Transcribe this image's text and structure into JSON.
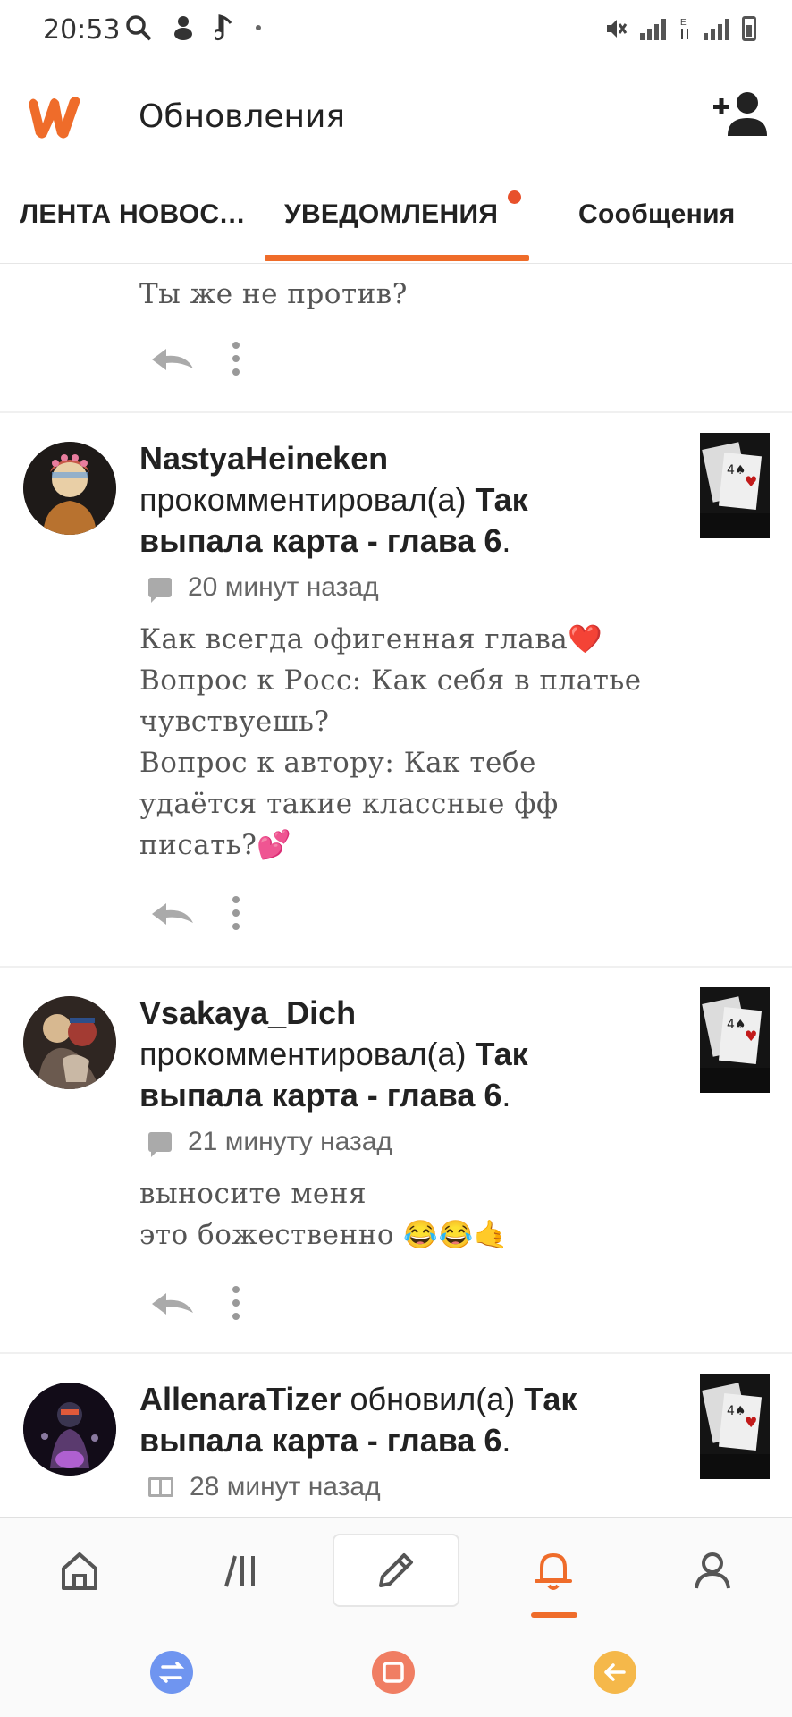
{
  "status_bar": {
    "time": "20:53"
  },
  "header": {
    "title": "Обновления"
  },
  "tabs": [
    {
      "label": "ЛЕНТА НОВОСТЕЙ",
      "active": false
    },
    {
      "label": "УВЕДОМЛЕНИЯ",
      "active": true
    },
    {
      "label": "Сообщения",
      "active": false
    }
  ],
  "partial_item": {
    "visible_line": "Ты же не против?"
  },
  "notifications": [
    {
      "user": "NastyaHeineken",
      "action": "прокомментировал(а)",
      "story": "Так выпала карта - глава 6",
      "suffix": ".",
      "time": "20 минут назад",
      "comment_lines": [
        "Как всегда офигенная глава❤️",
        "Вопрос к Росс: Как себя в платье",
        "чувствуешь?",
        "Вопрос к автору: Как тебе",
        "удаётся такие классные фф",
        "писать?💕"
      ]
    },
    {
      "user": "Vsakaya_Dich",
      "action": "прокомментировал(а)",
      "story": "Так выпала карта - глава 6",
      "suffix": ".",
      "time": "21 минуту назад",
      "comment_lines": [
        "выносите меня",
        "это божественно 😂😂🤙"
      ]
    },
    {
      "user": "AllenaraTizer",
      "action": "обновил(а)",
      "story": "Так выпала карта - глава 6",
      "suffix": ".",
      "time": "28 минут назад",
      "comment_lines": []
    }
  ],
  "colors": {
    "accent": "#ef6c2a",
    "notification_dot": "#e8512b",
    "sys_left": "#6f95f0",
    "sys_mid": "#f07e63",
    "sys_right": "#f5b84a"
  },
  "bottom_nav": {
    "icons": [
      "home-icon",
      "library-icon",
      "pencil-icon",
      "bell-icon",
      "profile-icon"
    ],
    "active": "bell-icon"
  }
}
